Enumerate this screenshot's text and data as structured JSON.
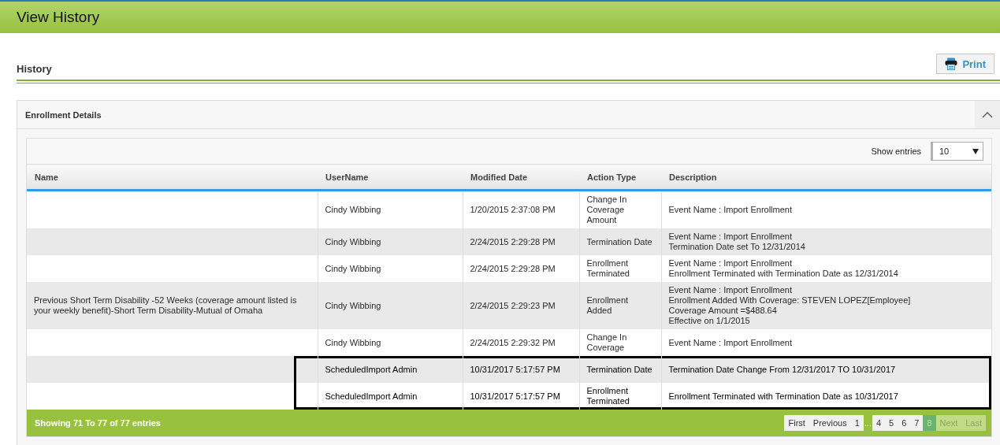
{
  "header": {
    "title": "View History"
  },
  "section": {
    "title": "History",
    "print_label": "Print"
  },
  "panel": {
    "title": "Enrollment Details",
    "expanded": true
  },
  "length": {
    "label": "Show entries",
    "value": "10"
  },
  "table": {
    "columns": [
      "Name",
      "UserName",
      "Modified Date",
      "Action Type",
      "Description"
    ],
    "rows": [
      {
        "cells": [
          "",
          "Cindy Wibbing",
          "1/20/2015 2:37:08 PM",
          "Change In Coverage Amount",
          "Event Name : Import Enrollment"
        ],
        "highlighted": false
      },
      {
        "cells": [
          "",
          "Cindy Wibbing",
          "2/24/2015 2:29:28 PM",
          "Termination Date",
          "Event Name : Import Enrollment\nTermination Date set To 12/31/2014"
        ],
        "highlighted": false
      },
      {
        "cells": [
          "",
          "Cindy Wibbing",
          "2/24/2015 2:29:28 PM",
          "Enrollment Terminated",
          "Event Name : Import Enrollment\nEnrollment Terminated with Termination Date as 12/31/2014"
        ],
        "highlighted": false
      },
      {
        "cells": [
          "Previous Short Term Disability -52 Weeks (coverage amount listed is your weekly benefit)-Short Term Disability-Mutual of Omaha",
          "Cindy Wibbing",
          "2/24/2015 2:29:23 PM",
          "Enrollment Added",
          "Event Name : Import Enrollment\nEnrollment Added With Coverage: STEVEN LOPEZ[Employee]\nCoverage Amount =$488.64\nEffective on 1/1/2015"
        ],
        "highlighted": false
      },
      {
        "cells": [
          "",
          "Cindy Wibbing",
          "2/24/2015 2:29:32 PM",
          "Change In Coverage",
          "Event Name : Import Enrollment"
        ],
        "highlighted": false
      },
      {
        "cells": [
          "",
          "ScheduledImport Admin",
          "10/31/2017 5:17:57 PM",
          "Termination Date",
          "Termination Date Change From 12/31/2017 TO 10/31/2017"
        ],
        "highlighted": true
      },
      {
        "cells": [
          "",
          "ScheduledImport Admin",
          "10/31/2017 5:17:57 PM",
          "Enrollment Terminated",
          "Enrollment Terminated with Termination Date as 10/31/2017"
        ],
        "highlighted": true
      }
    ]
  },
  "footer": {
    "info": "Showing 71 To 77 of 77 entries",
    "pages": [
      {
        "label": "First",
        "kind": "page",
        "selected": false,
        "disabled": false
      },
      {
        "label": "Previous",
        "kind": "page",
        "selected": false,
        "disabled": false
      },
      {
        "label": "1",
        "kind": "page",
        "selected": false,
        "disabled": false
      },
      {
        "label": "...",
        "kind": "gap"
      },
      {
        "label": "4",
        "kind": "page",
        "selected": false,
        "disabled": false
      },
      {
        "label": "5",
        "kind": "page",
        "selected": false,
        "disabled": false
      },
      {
        "label": "6",
        "kind": "page",
        "selected": false,
        "disabled": false
      },
      {
        "label": "7",
        "kind": "page",
        "selected": false,
        "disabled": false
      },
      {
        "label": "8",
        "kind": "page",
        "selected": true,
        "disabled": false
      },
      {
        "label": "Next",
        "kind": "page",
        "selected": false,
        "disabled": true
      },
      {
        "label": "Last",
        "kind": "page",
        "selected": false,
        "disabled": true
      }
    ]
  }
}
